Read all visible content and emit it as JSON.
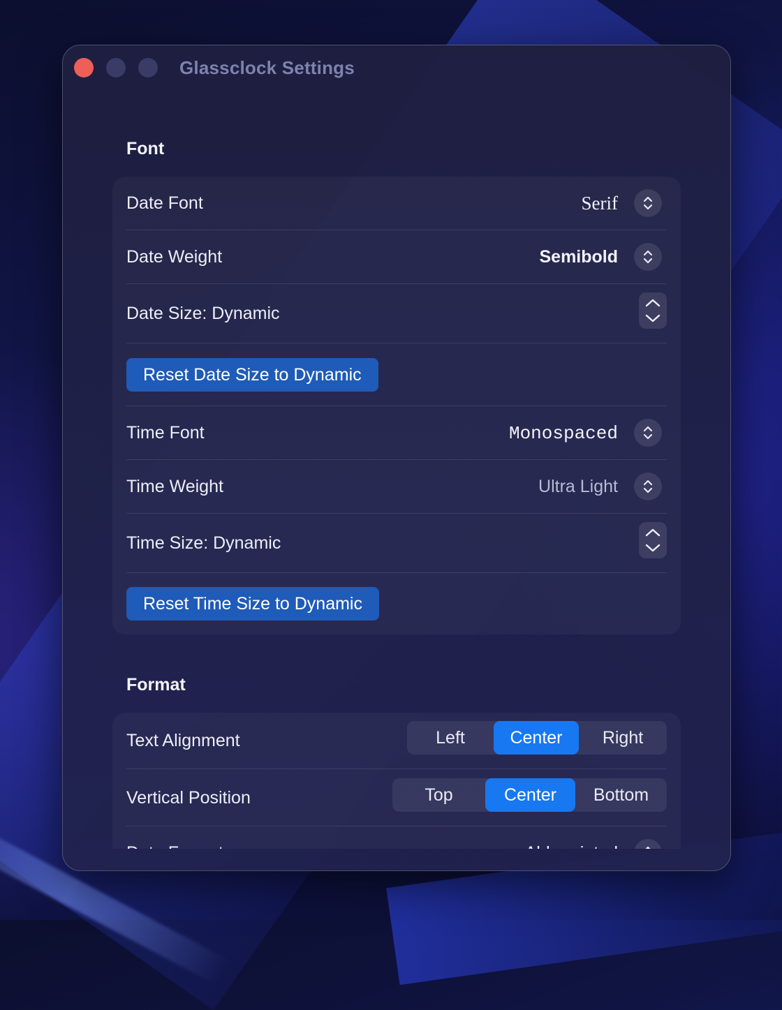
{
  "window": {
    "title": "Glassclock Settings"
  },
  "font_section": {
    "heading": "Font",
    "date_font": {
      "label": "Date Font",
      "value": "Serif"
    },
    "date_weight": {
      "label": "Date Weight",
      "value": "Semibold"
    },
    "date_size": {
      "label": "Date Size: Dynamic"
    },
    "reset_date_button": "Reset Date Size to Dynamic",
    "time_font": {
      "label": "Time Font",
      "value": "Monospaced"
    },
    "time_weight": {
      "label": "Time Weight",
      "value": "Ultra Light"
    },
    "time_size": {
      "label": "Time Size: Dynamic"
    },
    "reset_time_button": "Reset Time Size to Dynamic"
  },
  "format_section": {
    "heading": "Format",
    "text_alignment": {
      "label": "Text Alignment",
      "options": [
        "Left",
        "Center",
        "Right"
      ],
      "selected": "Center"
    },
    "vertical_position": {
      "label": "Vertical Position",
      "options": [
        "Top",
        "Center",
        "Bottom"
      ],
      "selected": "Center"
    },
    "date_format": {
      "label": "Date Format",
      "value": "Abbreviated"
    }
  },
  "colors": {
    "accent": "#1778f2",
    "button_blue": "#1f5bb8",
    "close": "#ed5f57"
  },
  "icons": {
    "popup": "chevron-up-down-icon",
    "stepper_up": "chevron-up-icon",
    "stepper_down": "chevron-down-icon"
  }
}
